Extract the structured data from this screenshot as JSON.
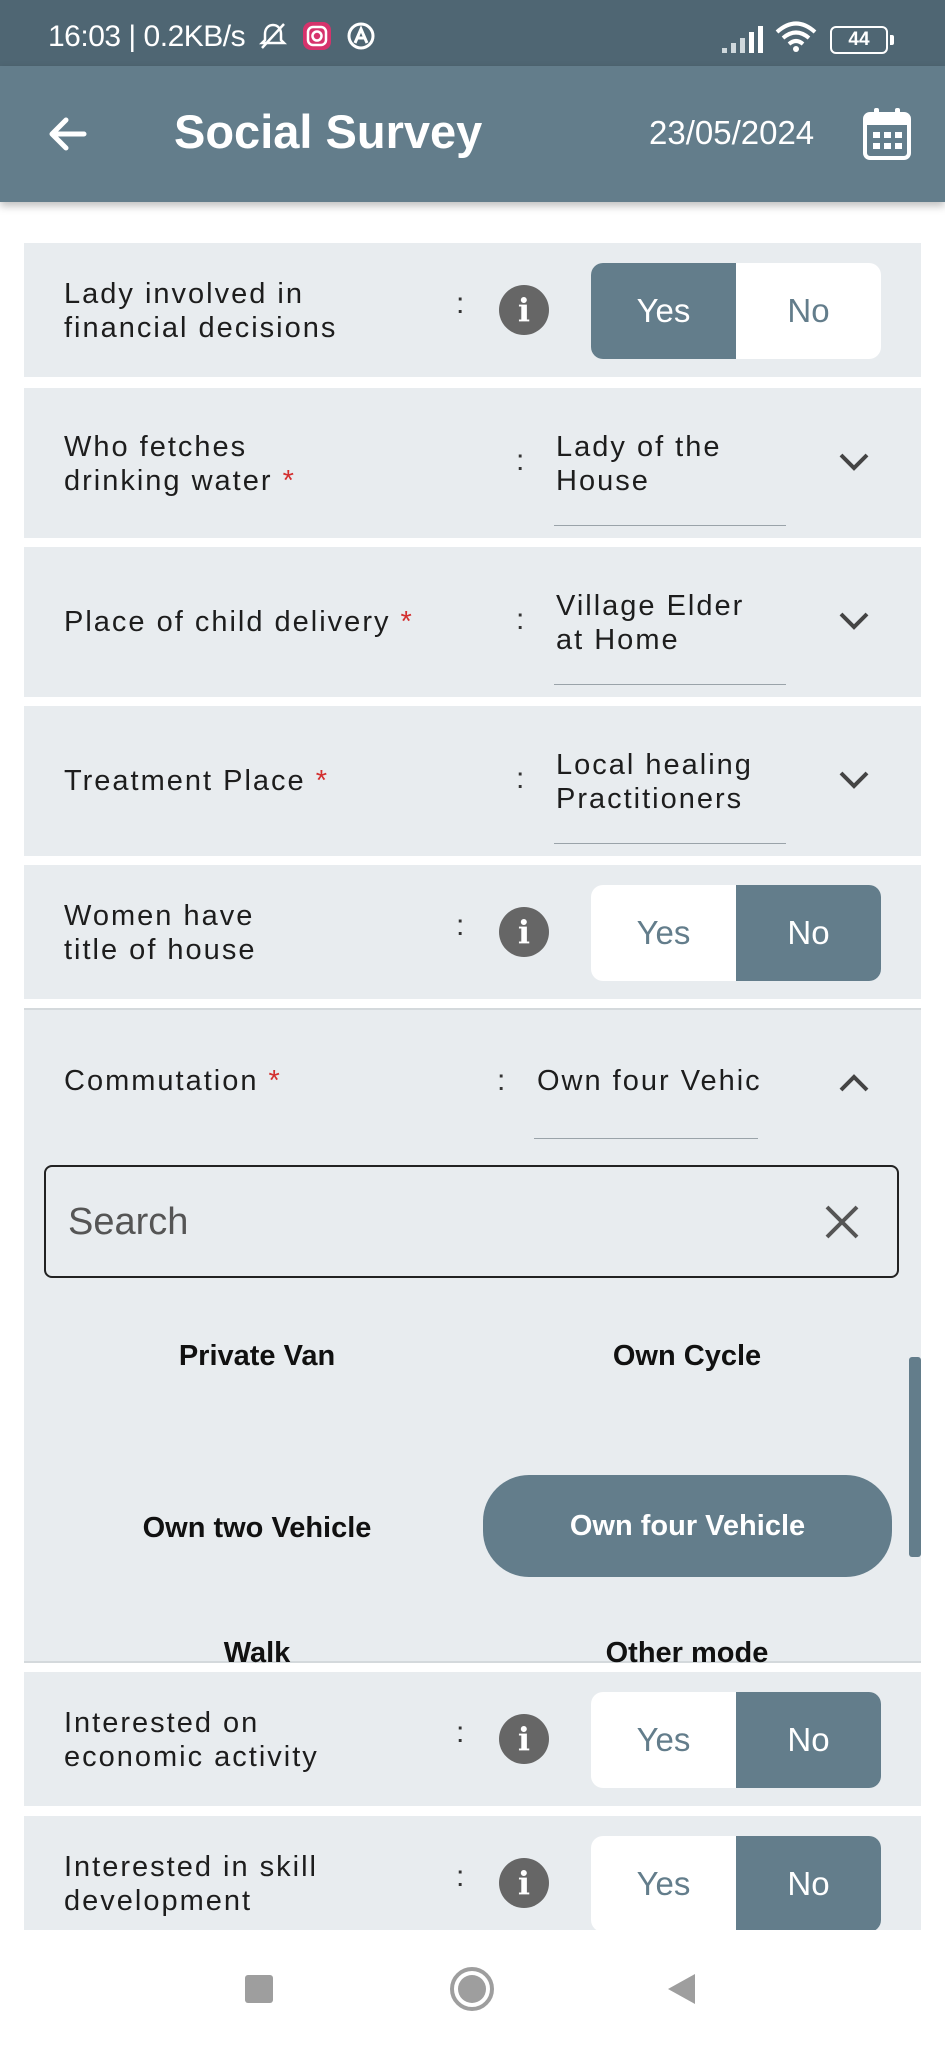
{
  "status_bar": {
    "time": "16:03",
    "net_speed": "0.2KB/s",
    "battery": "44"
  },
  "app_bar": {
    "title": "Social Survey",
    "date": "23/05/2024"
  },
  "fields": [
    {
      "label": "Lady involved in\nfinancial decisions",
      "type": "toggle",
      "yes": "Yes",
      "no": "No",
      "selected": "Yes"
    },
    {
      "label": "Who fetches\ndrinking water",
      "required": "*",
      "type": "dropdown",
      "value": "Lady of the\nHouse"
    },
    {
      "label": "Place of child delivery",
      "required": "*",
      "type": "dropdown",
      "value": "Village Elder\nat Home"
    },
    {
      "label": "Treatment Place",
      "required": "*",
      "type": "dropdown",
      "value": "Local healing\nPractitioners"
    },
    {
      "label": "Women have\ntitle of house",
      "type": "toggle",
      "yes": "Yes",
      "no": "No",
      "selected": "No"
    },
    {
      "label": "Commutation",
      "required": "*",
      "type": "dropdown-open",
      "value": "Own four Vehic"
    },
    {
      "label": "Interested on\neconomic activity",
      "type": "toggle",
      "yes": "Yes",
      "no": "No",
      "selected": "No"
    },
    {
      "label": "Interested in skill\ndevelopment",
      "type": "toggle",
      "yes": "Yes",
      "no": "No",
      "selected": "No"
    }
  ],
  "colon": ":",
  "info_glyph": "i",
  "commutation_dropdown": {
    "search_placeholder": "Search",
    "options": [
      "Private Van",
      "Own Cycle",
      "Own two Vehicle",
      "Own four Vehicle",
      "Walk",
      "Other mode"
    ],
    "selected": "Own four Vehicle"
  },
  "colors": {
    "primary": "#637d8b",
    "status_bar": "#4f6673",
    "card_bg": "#e8ecef",
    "required": "#d32f2f"
  }
}
